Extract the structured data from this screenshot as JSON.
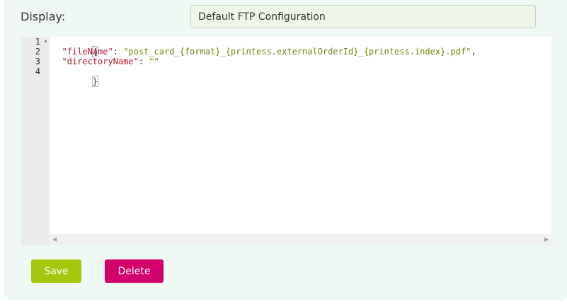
{
  "form": {
    "display_label": "Display:",
    "display_value": "Default FTP Configuration"
  },
  "editor": {
    "line_numbers": [
      "1",
      "2",
      "3",
      "4"
    ],
    "lines": {
      "l1": {
        "open_brace": "{"
      },
      "l2": {
        "key": "\"fileName\"",
        "colon": ": ",
        "value": "\"post_card_{format}_{printess.externalOrderId}_{printess.index}.pdf\"",
        "comma": ","
      },
      "l3": {
        "key": "\"directoryName\"",
        "colon": ": ",
        "value": "\"\""
      },
      "l4": {
        "close_brace": "}"
      }
    },
    "fold_icon": "fold-arrow-icon",
    "scroll_left_icon": "arrow-left-icon",
    "scroll_right_icon": "arrow-right-icon"
  },
  "actions": {
    "save_label": "Save",
    "delete_label": "Delete"
  },
  "colors": {
    "panel_bg": "#eff8f3",
    "save": "#a3c80e",
    "delete": "#d2006b",
    "json_key": "#b11c2e",
    "json_string": "#6a8a0e"
  }
}
